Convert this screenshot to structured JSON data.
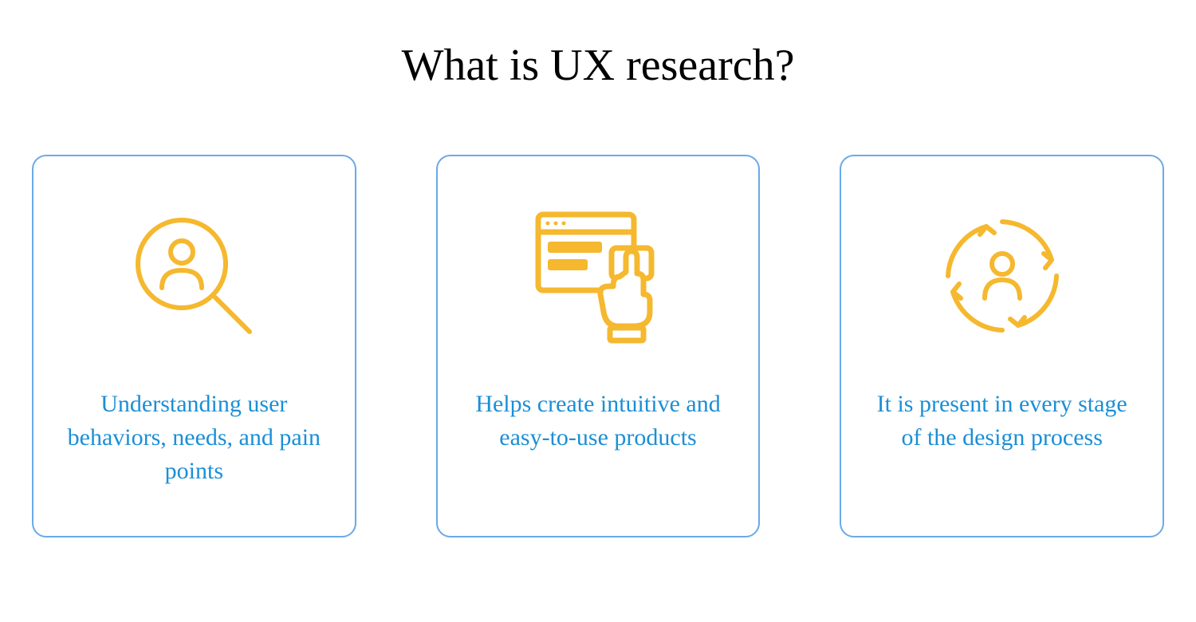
{
  "title": "What is UX research?",
  "cards": [
    {
      "icon": "search-user-icon",
      "text": "Understanding user behaviors, needs, and pain points"
    },
    {
      "icon": "touch-interface-icon",
      "text": "Helps create intuitive and easy-to-use products"
    },
    {
      "icon": "user-cycle-icon",
      "text": "It is present in every stage of the design process"
    }
  ],
  "colors": {
    "border": "#6ba9e8",
    "text": "#1a8fd6",
    "icon": "#f5b82e"
  }
}
